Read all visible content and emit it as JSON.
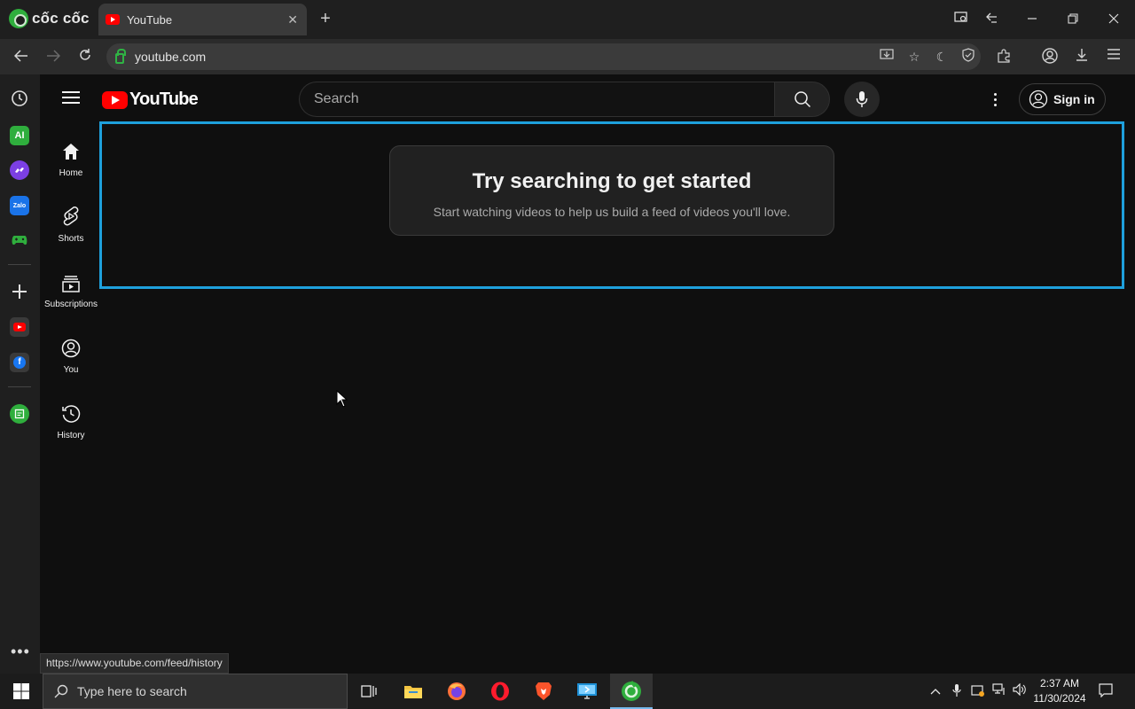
{
  "browser": {
    "brand_name": "cốc cốc",
    "tab_title": "YouTube",
    "tab_close": "✕",
    "new_tab": "+",
    "url": "youtube.com",
    "status_url": "https://www.youtube.com/feed/history",
    "more": "•••"
  },
  "youtube": {
    "logo_text": "YouTube",
    "search_placeholder": "Search",
    "sign_in": "Sign in",
    "guide": [
      {
        "label": "Home"
      },
      {
        "label": "Shorts"
      },
      {
        "label": "Subscriptions"
      },
      {
        "label": "You"
      },
      {
        "label": "History"
      }
    ],
    "card_title": "Try searching to get started",
    "card_subtitle": "Start watching videos to help us build a feed of videos you'll love."
  },
  "taskbar": {
    "search_placeholder": "Type here to search",
    "time": "2:37 AM",
    "date": "11/30/2024"
  },
  "colors": {
    "highlight": "#1ea0dc",
    "youtube_red": "#ff0000",
    "background": "#0f0f0f"
  }
}
